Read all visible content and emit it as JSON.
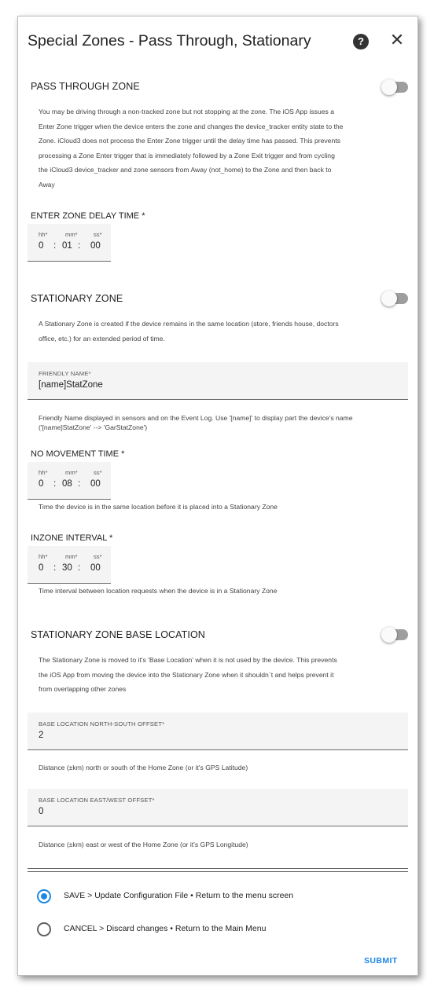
{
  "dialog": {
    "title": "Special Zones - Pass Through, Stationary",
    "help_icon": "question-mark-circle-icon",
    "help_glyph": "?",
    "close_icon": "close-icon",
    "close_glyph": "✕"
  },
  "pass_through": {
    "title": "PASS THROUGH ZONE",
    "toggle_on": false,
    "description_lines": [
      "You may be driving through a non-tracked zone but not stopping at the zone. The iOS App issues a",
      "Enter Zone trigger when the device enters the zone and changes the device_tracker entity state to the",
      "Zone. iCloud3 does not process the Enter Zone trigger until the delay time has passed. This prevents",
      "processing a Zone Enter trigger that is immediately followed by a Zone Exit trigger and from cycling",
      "the iCloud3 device_tracker and zone sensors from Away (not_home) to the Zone and then back to",
      "Away"
    ]
  },
  "enter_zone_delay": {
    "label": "ENTER ZONE DELAY TIME *",
    "hh_label": "hh*",
    "mm_label": "mm*",
    "ss_label": "ss*",
    "hh": "0",
    "mm": "01",
    "ss": "00"
  },
  "stationary": {
    "title": "STATIONARY ZONE",
    "toggle_on": false,
    "description_lines": [
      "A Stationary Zone is created if the device remains in the same location (store, friends house, doctors",
      "office, etc.) for an extended period of time."
    ]
  },
  "friendly_name": {
    "label": "FRIENDLY NAME*",
    "value": "[name]StatZone",
    "helper_lines": [
      "Friendly Name displayed in sensors and on the Event Log. Use '[name]' to display part the device's name",
      "('[name]StatZone' --> 'GarStatZone')"
    ]
  },
  "no_movement": {
    "label": "NO MOVEMENT TIME *",
    "hh_label": "hh*",
    "mm_label": "mm*",
    "ss_label": "ss*",
    "hh": "0",
    "mm": "08",
    "ss": "00",
    "helper": "Time the device is in the same location before it is placed into a Stationary Zone"
  },
  "inzone_interval": {
    "label": "INZONE INTERVAL *",
    "hh_label": "hh*",
    "mm_label": "mm*",
    "ss_label": "ss*",
    "hh": "0",
    "mm": "30",
    "ss": "00",
    "helper": "Time interval between location requests when the device is in a Stationary Zone"
  },
  "base_location": {
    "title": "STATIONARY ZONE BASE LOCATION",
    "toggle_on": false,
    "description_lines": [
      "The Stationary Zone is moved to it's 'Base Location' when it is not used by the device. This prevents",
      "the iOS App from moving the device into the Stationary Zone when it shouldn`t and helps prevent it",
      "from overlapping other zones"
    ]
  },
  "ns_offset": {
    "label": "BASE LOCATION NORTH-SOUTH OFFSET*",
    "value": "2",
    "helper": "Distance (±km) north or south of the Home Zone (or it's GPS Latitude)"
  },
  "ew_offset": {
    "label": "BASE LOCATION EAST/WEST OFFSET*",
    "value": "0",
    "helper": "Distance (±km) east or west of the Home Zone (or it's GPS Longitude)"
  },
  "actions": {
    "options": [
      {
        "label": "SAVE > Update Configuration File • Return to the menu screen",
        "selected": true
      },
      {
        "label": "CANCEL > Discard changes • Return to the Main Menu",
        "selected": false
      }
    ],
    "submit_label": "SUBMIT"
  },
  "colors": {
    "accent": "#1e88e5",
    "field_bg": "#f4f4f4",
    "toggle_off_track": "#9e9e9e"
  }
}
